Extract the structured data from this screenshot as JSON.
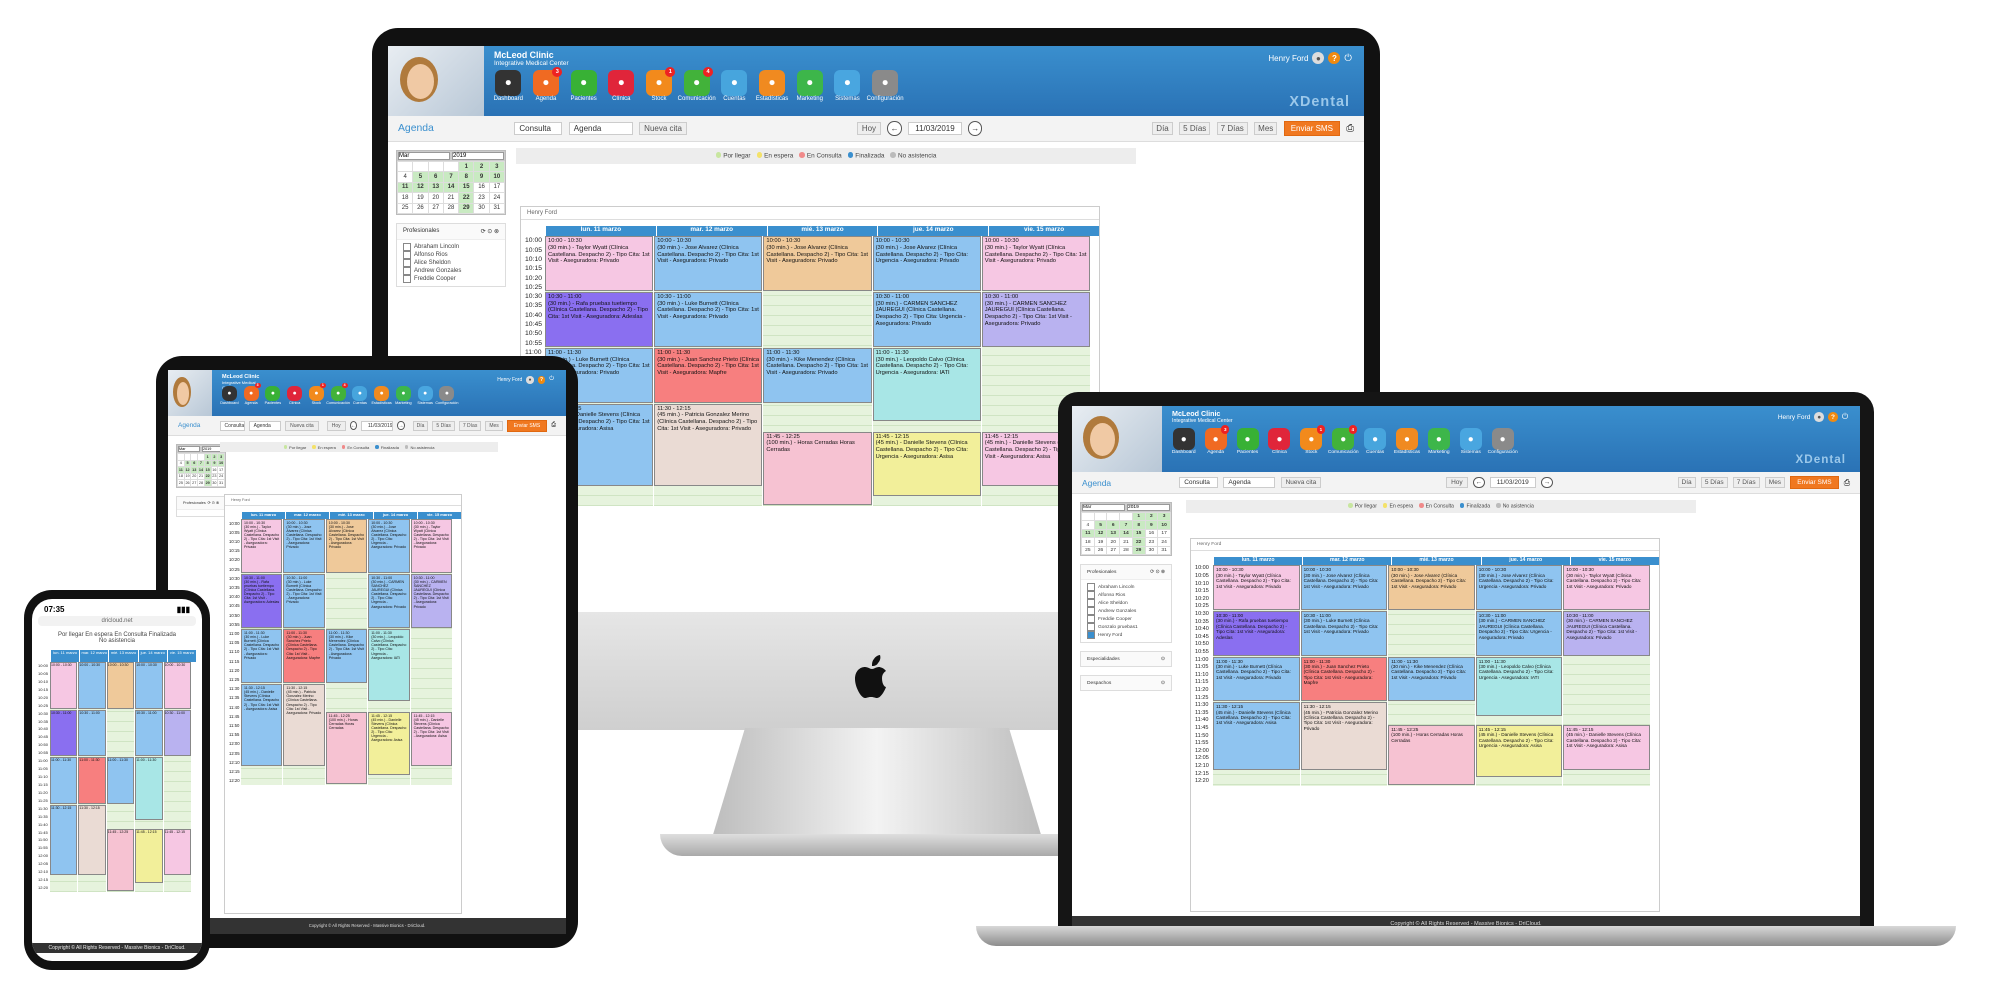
{
  "app": {
    "clinic_name": "McLeod Clinic",
    "clinic_subtitle": "Integrative Medical Center",
    "user": "Henry Ford",
    "brand": "XDental",
    "nav": [
      {
        "label": "Dashboard",
        "icon": "dashboard-icon",
        "color": "#333333",
        "badge": ""
      },
      {
        "label": "Agenda",
        "icon": "phone-icon",
        "color": "#f06a22",
        "badge": "3"
      },
      {
        "label": "Pacientes",
        "icon": "patient-icon",
        "color": "#38b135",
        "badge": ""
      },
      {
        "label": "Clínica",
        "icon": "clipboard-icon",
        "color": "#e0253a",
        "badge": ""
      },
      {
        "label": "Stock",
        "icon": "box-icon",
        "color": "#f28a1c",
        "badge": "1"
      },
      {
        "label": "Comunicación",
        "icon": "chat-icon",
        "color": "#42b23a",
        "badge": "4"
      },
      {
        "label": "Cuentas",
        "icon": "accounts-icon",
        "color": "#47a5dd",
        "badge": ""
      },
      {
        "label": "Estadísticas",
        "icon": "chart-icon",
        "color": "#f08a20",
        "badge": ""
      },
      {
        "label": "Marketing",
        "icon": "share-icon",
        "color": "#3db64a",
        "badge": ""
      },
      {
        "label": "Sistemas",
        "icon": "globe-icon",
        "color": "#49a6e0",
        "badge": ""
      },
      {
        "label": "Configuración",
        "icon": "settings-icon",
        "color": "#8a8a8a",
        "badge": ""
      }
    ]
  },
  "toolbar": {
    "section": "Agenda",
    "consulta": "Consulta",
    "agenda": "Agenda",
    "nueva_cita": "Nueva cita",
    "hoy": "Hoy",
    "date": "11/03/2019",
    "views": [
      "Día",
      "5 Días",
      "7 Días",
      "Mes"
    ],
    "sms": "Enviar SMS"
  },
  "legend": [
    {
      "label": "Por llegar",
      "color": "#c8e6a0"
    },
    {
      "label": "En espera",
      "color": "#f4e26a"
    },
    {
      "label": "En Consulta",
      "color": "#f08a8a"
    },
    {
      "label": "Finalizada",
      "color": "#3a8fce"
    },
    {
      "label": "No asistencia",
      "color": "#bbbbbb"
    }
  ],
  "mini_calendar": {
    "month": "Mar",
    "year": "2019",
    "rows": [
      [
        "",
        "",
        "",
        "",
        "1",
        "2",
        "3"
      ],
      [
        "4",
        "5",
        "6",
        "7",
        "8",
        "9",
        "10"
      ],
      [
        "11",
        "12",
        "13",
        "14",
        "15",
        "16",
        "17"
      ],
      [
        "18",
        "19",
        "20",
        "21",
        "22",
        "23",
        "24"
      ],
      [
        "25",
        "26",
        "27",
        "28",
        "29",
        "30",
        "31"
      ]
    ]
  },
  "professionals": {
    "title": "Profesionales",
    "items": [
      "Abraham Lincoln",
      "Alfonso Rios",
      "Alice Sheldon",
      "Andrew Gonzales",
      "Freddie Cooper",
      "Gonzalo pruebas1",
      "Henry Ford"
    ]
  },
  "panels": {
    "especialidades": "Especialidades",
    "despachos": "Despachos"
  },
  "calendar": {
    "owner": "Henry Ford",
    "days": [
      "lun. 11 marzo",
      "mar. 12 marzo",
      "mié. 13 marzo",
      "jue. 14 marzo",
      "vie. 15 marzo"
    ],
    "times": [
      "10:00",
      "10:05",
      "10:10",
      "10:15",
      "10:20",
      "10:25",
      "10:30",
      "10:35",
      "10:40",
      "10:45",
      "10:50",
      "10:55",
      "11:00",
      "11:05",
      "11:10",
      "11:15",
      "11:20",
      "11:25",
      "11:30",
      "11:35",
      "11:40",
      "11:45",
      "11:50",
      "11:55",
      "12:00",
      "12:05",
      "12:10",
      "12:15",
      "12:20"
    ],
    "appointments": [
      {
        "day": 0,
        "start": 0,
        "len": 6,
        "color": "#f6c7e3",
        "time": "10:00 - 10:30",
        "text": "(30 min.) - Taylor Wyatt (Clínica Castellana. Despacho 2) - Tipo Cita: 1st Visit - Aseguradora: Privado"
      },
      {
        "day": 0,
        "start": 6,
        "len": 6,
        "color": "#8a6ff0",
        "time": "10:30 - 11:00",
        "text": "(30 min.) - Rafa pruebas tuetiempo (Clínica Castellana. Despacho 2) - Tipo Cita: 1st Visit - Aseguradora: Adeslas"
      },
      {
        "day": 0,
        "start": 12,
        "len": 6,
        "color": "#8fc4f0",
        "time": "11:00 - 11:30",
        "text": "(30 min.) - Luke Burnett (Clínica Castellana. Despacho 2) - Tipo Cita: 1st Visit - Aseguradora: Privado"
      },
      {
        "day": 0,
        "start": 18,
        "len": 9,
        "color": "#8fc4f0",
        "time": "11:30 - 12:15",
        "text": "(45 min.) - Danielle Stevens (Clínica Castellana. Despacho 2) - Tipo Cita: 1st Visit - Aseguradora: Asisa"
      },
      {
        "day": 1,
        "start": 0,
        "len": 6,
        "color": "#8fc4f0",
        "time": "10:00 - 10:30",
        "text": "(30 min.) - Jose Alvarez (Clínica Castellana. Despacho 2) - Tipo Cita: 1st Visit - Aseguradora: Privado"
      },
      {
        "day": 1,
        "start": 6,
        "len": 6,
        "color": "#8fc4f0",
        "time": "10:30 - 11:00",
        "text": "(30 min.) - Luke Burnett (Clínica Castellana. Despacho 2) - Tipo Cita: 1st Visit - Aseguradora: Privado"
      },
      {
        "day": 1,
        "start": 12,
        "len": 6,
        "color": "#f77f7f",
        "time": "11:00 - 11:30",
        "text": "(30 min.) - Juan Sanchez Prieto (Clínica Castellana. Despacho 2) - Tipo Cita: 1st Visit - Aseguradora: Mapfre"
      },
      {
        "day": 1,
        "start": 18,
        "len": 9,
        "color": "#eadbd4",
        "time": "11:30 - 12:15",
        "text": "(45 min.) - Patricia Gonzalez Merino (Clínica Castellana. Despacho 2) - Tipo Cita: 1st Visit - Aseguradora: Privado"
      },
      {
        "day": 2,
        "start": 0,
        "len": 6,
        "color": "#efc99a",
        "time": "10:00 - 10:30",
        "text": "(30 min.) - Jose Alvarez (Clínica Castellana. Despacho 2) - Tipo Cita: 1st Visit - Aseguradora: Privado"
      },
      {
        "day": 2,
        "start": 12,
        "len": 6,
        "color": "#8fc4f0",
        "time": "11:00 - 11:30",
        "text": "(30 min.) - Kike Menendez (Clínica Castellana. Despacho 2) - Tipo Cita: 1st Visit - Aseguradora: Privado"
      },
      {
        "day": 2,
        "start": 21,
        "len": 8,
        "color": "#f6c2d2",
        "time": "11:45 - 12:25",
        "text": "(100 min.) - Horas Cerradas Horas Cerradas"
      },
      {
        "day": 3,
        "start": 0,
        "len": 6,
        "color": "#8fc4f0",
        "time": "10:00 - 10:30",
        "text": "(30 min.) - Jose Alvarez (Clínica Castellana. Despacho 2) - Tipo Cita: Urgencia - Aseguradora: Privado"
      },
      {
        "day": 3,
        "start": 6,
        "len": 6,
        "color": "#8fc4f0",
        "time": "10:30 - 11:00",
        "text": "(30 min.) - CARMEN SANCHEZ JAUREGUI (Clínica Castellana. Despacho 2) - Tipo Cita: Urgencia - Aseguradora: Privado"
      },
      {
        "day": 3,
        "start": 12,
        "len": 8,
        "color": "#a8e6e6",
        "time": "11:00 - 11:30",
        "text": "(30 min.) - Leopoldo Calvo (Clínica Castellana. Despacho 2) - Tipo Cita: Urgencia - Aseguradora: IATI"
      },
      {
        "day": 3,
        "start": 21,
        "len": 7,
        "color": "#f2ef9a",
        "time": "11:45 - 12:15",
        "text": "(45 min.) - Danielle Stevens (Clínica Castellana. Despacho 2) - Tipo Cita: Urgencia - Aseguradora: Asisa"
      },
      {
        "day": 4,
        "start": 0,
        "len": 6,
        "color": "#f6c7e3",
        "time": "10:00 - 10:30",
        "text": "(30 min.) - Taylor Wyatt (Clínica Castellana. Despacho 2) - Tipo Cita: 1st Visit - Aseguradora: Privado"
      },
      {
        "day": 4,
        "start": 6,
        "len": 6,
        "color": "#b9b2f0",
        "time": "10:30 - 11:00",
        "text": "(30 min.) - CARMEN SANCHEZ JAUREGUI (Clínica Castellana. Despacho 2) - Tipo Cita: 1st Visit - Aseguradora: Privado"
      },
      {
        "day": 4,
        "start": 21,
        "len": 6,
        "color": "#f6c7e3",
        "time": "11:45 - 12:15",
        "text": "(45 min.) - Danielle Stevens (Clínica Castellana. Despacho 2) - Tipo Cita: 1st Visit - Aseguradora: Asisa"
      }
    ]
  },
  "footer": "Copyright © All Rights Reserved - Massive Bionics - DriCloud.",
  "phone": {
    "clock": "07:35",
    "url": "dricloud.net",
    "legend_line1": "Por llegar  En espera  En Consulta  Finalizada",
    "legend_line2": "No asistencia"
  }
}
